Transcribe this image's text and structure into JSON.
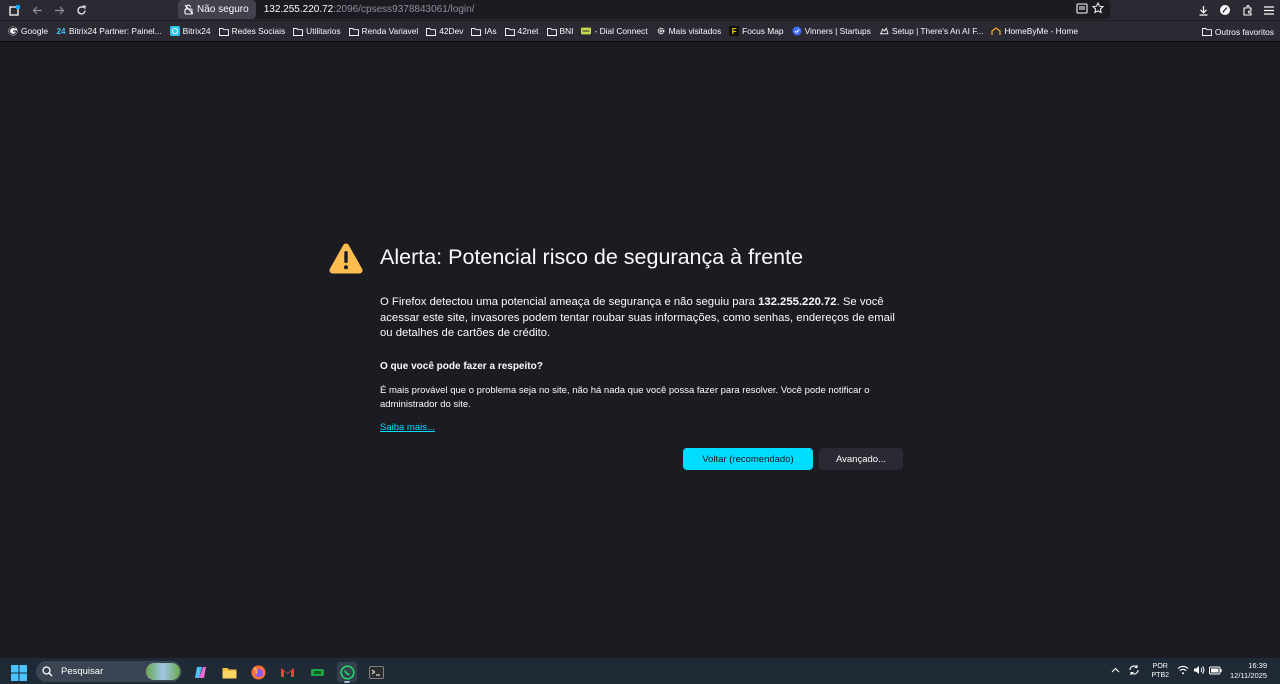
{
  "browser": {
    "security_label": "Não seguro",
    "url_host": "132.255.220.72",
    "url_rest": ":2096/cpsess9378843061/login/"
  },
  "bookmarks": {
    "items": [
      {
        "label": "Google",
        "icon": "google-icon"
      },
      {
        "label": "Bitrix24 Partner: Painel...",
        "icon": "bitrix-icon"
      },
      {
        "label": "Bitrix24",
        "icon": "bitrix-icon"
      },
      {
        "label": "Redes Sociais",
        "icon": "folder-icon"
      },
      {
        "label": "Utilitarios",
        "icon": "folder-icon"
      },
      {
        "label": "Renda Variavel",
        "icon": "folder-icon"
      },
      {
        "label": "42Dev",
        "icon": "folder-icon"
      },
      {
        "label": "IAs",
        "icon": "folder-icon"
      },
      {
        "label": "42net",
        "icon": "folder-icon"
      },
      {
        "label": "BNI",
        "icon": "folder-icon"
      },
      {
        "label": "- Dial Connect",
        "icon": "dial-connect-icon"
      },
      {
        "label": "Mais visitados",
        "icon": "gear-icon"
      },
      {
        "label": "Focus Map",
        "icon": "focus-map-icon"
      },
      {
        "label": "Vinners | Startups",
        "icon": "vinners-icon"
      },
      {
        "label": "Setup | There's An AI F...",
        "icon": "setup-icon"
      },
      {
        "label": "HomeByMe - Home",
        "icon": "homebyme-icon"
      }
    ],
    "other_label": "Outros favoritos"
  },
  "error_page": {
    "title": "Alerta: Potencial risco de segurança à frente",
    "desc_before": "O Firefox detectou uma potencial ameaça de segurança e não seguiu para ",
    "desc_host": "132.255.220.72",
    "desc_after": ". Se você acessar este site, invasores podem tentar roubar suas informações, como senhas, endereços de email ou detalhes de cartões de crédito.",
    "subheading": "O que você pode fazer a respeito?",
    "advice": "É mais provável que o problema seja no site, não há nada que você possa fazer para resolver. Você pode notificar o administrador do site.",
    "learn_more": "Saiba mais...",
    "back_button": "Voltar (recomendado)",
    "advanced_button": "Avançado...",
    "colors": {
      "accent": "#00ddff",
      "warning": "#ffbd4f",
      "background": "#1c1b22"
    }
  },
  "taskbar": {
    "search_placeholder": "Pesquisar",
    "lang_top": "POR",
    "lang_bottom": "PTB2",
    "time": "16:39",
    "date": "12/11/2025"
  }
}
